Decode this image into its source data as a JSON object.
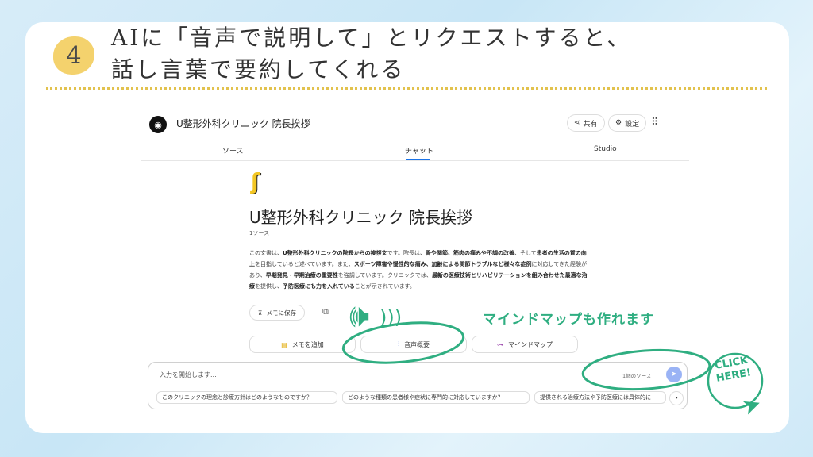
{
  "slide": {
    "step_number": "4",
    "headline_line1": "AIに「音声で説明して」とリクエストすると、",
    "headline_line2": "話し言葉で要約してくれる"
  },
  "app": {
    "title": "U整形外科クリニック 院長挨拶",
    "header_buttons": {
      "share": "共有",
      "settings": "設定"
    },
    "tabs": [
      "ソース",
      "チャット",
      "Studio"
    ],
    "active_tab": "チャット",
    "notebook": {
      "title": "U整形外科クリニック 院長挨拶",
      "source_count": "1ソース",
      "summary_parts": [
        {
          "text": "この文書は、",
          "bold": false
        },
        {
          "text": "U整形外科クリニックの院長からの挨拶文",
          "bold": true
        },
        {
          "text": "です。院長は、",
          "bold": false
        },
        {
          "text": "骨や関節、筋肉の痛みや不調の改善",
          "bold": true
        },
        {
          "text": "、そして",
          "bold": false
        },
        {
          "text": "患者の生活の質の向上",
          "bold": true
        },
        {
          "text": "を目指していると述べています。また、",
          "bold": false
        },
        {
          "text": "スポーツ障害や慢性的な痛み、加齢による関節トラブルなど様々な症例",
          "bold": true
        },
        {
          "text": "に対応してきた経験があり、",
          "bold": false
        },
        {
          "text": "早期発見・早期治療の重要性",
          "bold": true
        },
        {
          "text": "を強調しています。クリニックでは、",
          "bold": false
        },
        {
          "text": "最新の医療技術とリハビリテーションを組み合わせた最適な治療",
          "bold": true
        },
        {
          "text": "を提供し、",
          "bold": false
        },
        {
          "text": "予防医療にも力を入れている",
          "bold": true
        },
        {
          "text": "ことが示されています。",
          "bold": false
        }
      ],
      "save_to_memo": "メモに保存",
      "actions": [
        "メモを追加",
        "音声概要",
        "マインドマップ"
      ]
    },
    "chat_input": {
      "placeholder": "入力を開始します...",
      "source_count": "1個のソース",
      "suggestions": [
        "このクリニックの理念と診療方針はどのようなものですか？",
        "どのような種類の患者様や症状に専門的に対応していますか？",
        "提供される治療方法や予防医療には具体的に"
      ]
    }
  },
  "annotations": {
    "mindmap_note": "マインドマップも作れます",
    "click_here_line1": "CLICK",
    "click_here_line2": "HERE!"
  },
  "colors": {
    "accent_green": "#2fae81",
    "badge_yellow": "#f4d26d",
    "tab_blue": "#1a73e8"
  }
}
